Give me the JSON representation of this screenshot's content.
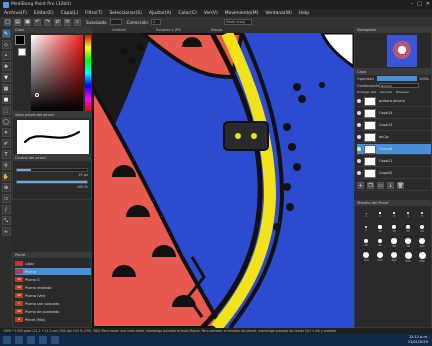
{
  "window": {
    "title": "MediBang Paint Pro (32bit)"
  },
  "menu": [
    "Archivo(F)",
    "Editar(E)",
    "Capa(L)",
    "Filtro(T)",
    "Seleccionar(S)",
    "Ajustar(A)",
    "Color(C)",
    "Ver(V)",
    "Movimiento(M)",
    "Ventana(W)",
    "Help"
  ],
  "toolbar": {
    "snap_label": "Suavizado",
    "correction_label": "Corrección",
    "correction_value": "4",
    "snap_box": "Modo snap"
  },
  "canvas_tabs": [
    "Untitled",
    "Escaneo 1.JPG",
    "Dibujo"
  ],
  "panels": {
    "color": "Color",
    "brush_preview": "Vista previa del pincel",
    "brush_control": "Control del pincel",
    "brush_list": "Pincel",
    "navigator": "Navegador",
    "layers": "Capa",
    "brush_size": "Tamaño del Pincel"
  },
  "brush_control": {
    "size_value": "15 px",
    "opacity_value": "100 %"
  },
  "brushes": [
    {
      "num": "",
      "name": "Lápiz"
    },
    {
      "num": "",
      "name": "Pluma"
    },
    {
      "num": "15",
      "name": "Pluma G"
    },
    {
      "num": "20",
      "name": "Pluma redonda"
    },
    {
      "num": "40",
      "name": "Pluma (Ver)"
    },
    {
      "num": "7",
      "name": "Pluma con costuras"
    },
    {
      "num": "20",
      "name": "Pluma de punteado"
    },
    {
      "num": "6",
      "name": "Pincel (Mix)"
    }
  ],
  "layers_panel": {
    "opacity_label": "Opacidad",
    "opacity_value": "100%",
    "blend_label": "Combinación",
    "blend_value": "Normal",
    "options": [
      "Proteger alfa",
      "Recorte",
      "Bloquear"
    ],
    "rows": [
      {
        "name": "pulsera pincho"
      },
      {
        "name": "Capa14"
      },
      {
        "name": "Capa13"
      },
      {
        "name": "ani2p"
      },
      {
        "name": "Capa46"
      },
      {
        "name": "Capa21"
      },
      {
        "name": "Capa20"
      }
    ],
    "selected_index": 4
  },
  "brush_sizes": [
    "1",
    "2",
    "3",
    "4",
    "5",
    "7",
    "10",
    "15",
    "20",
    "25",
    "30",
    "40",
    "50",
    "70",
    "100",
    "150",
    "200",
    "300",
    "500",
    "800"
  ],
  "status": "1500 * 1500 pixel  (21.1 * 21.2 cm)  300 dpi  100 %  (752, 382)  Para trazar una línea recta, mantenga pulsada la tecla Mayús. Para cambiar el tamaño del pincel, mantenga pulsada las teclas Ctrl + Alt y arrastre",
  "clock": {
    "time": "12:12 p.m.",
    "date": "21/01/2019"
  }
}
